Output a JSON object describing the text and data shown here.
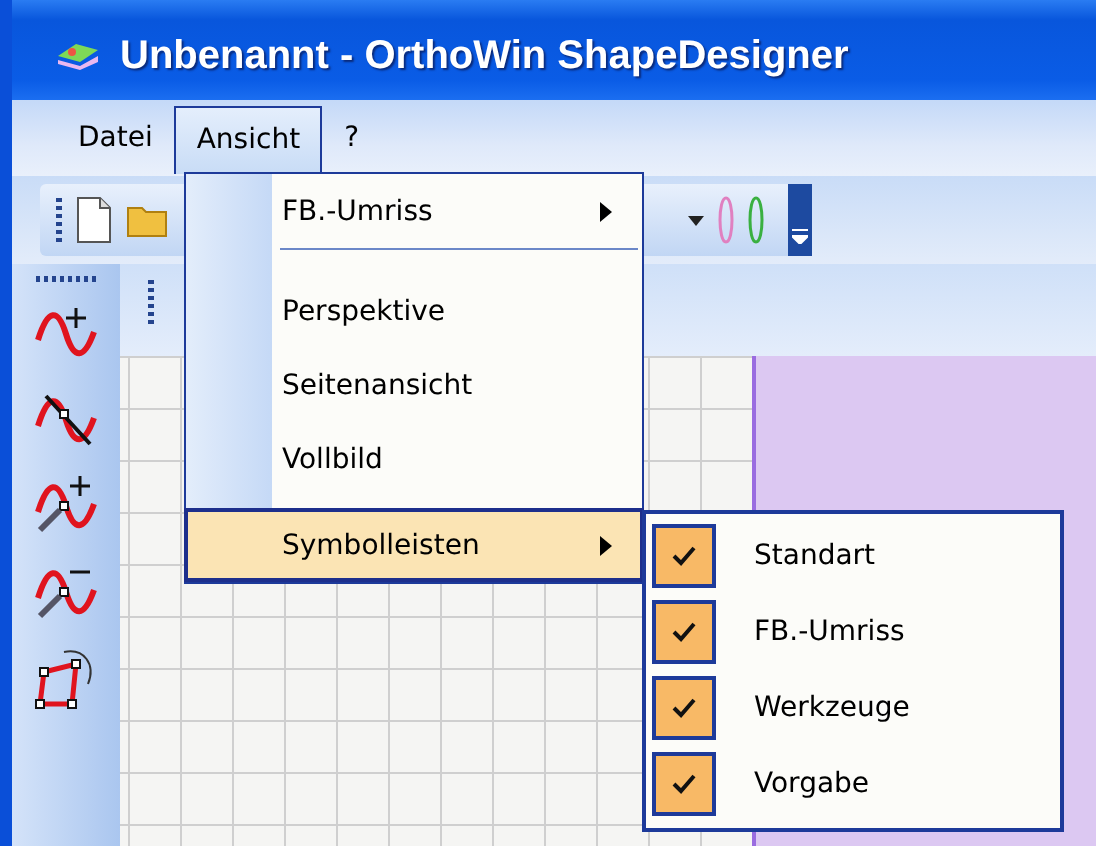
{
  "window": {
    "title": "Unbenannt - OrthoWin ShapeDesigner"
  },
  "menubar": [
    {
      "label": "Datei",
      "selected": false
    },
    {
      "label": "Ansicht",
      "selected": true
    },
    {
      "label": "?",
      "selected": false
    }
  ],
  "menu": [
    {
      "kind": "submenu",
      "label": "FB.-Umriss",
      "selected": false
    },
    {
      "kind": "separator"
    },
    {
      "kind": "item",
      "label": "Perspektive",
      "selected": false
    },
    {
      "kind": "item",
      "label": "Seitenansicht",
      "selected": false
    },
    {
      "kind": "item",
      "label": "Vollbild",
      "selected": false
    },
    {
      "kind": "submenu",
      "label": "Symbolleisten",
      "selected": true
    }
  ],
  "submenu": [
    {
      "label": "Standart",
      "checked": true
    },
    {
      "label": "FB.-Umriss",
      "checked": true
    },
    {
      "label": "Werkzeuge",
      "checked": true
    },
    {
      "label": "Vorgabe",
      "checked": true
    }
  ]
}
